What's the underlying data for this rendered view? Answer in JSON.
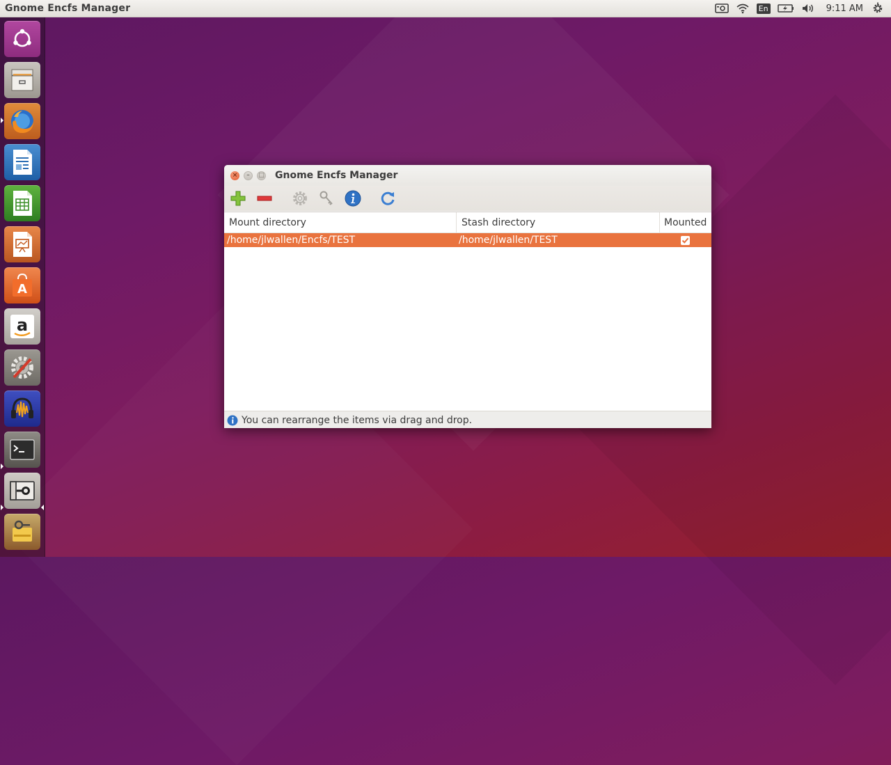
{
  "top_panel": {
    "app_title": "Gnome Encfs Manager",
    "keyboard_layout": "En",
    "clock": "9:11 AM",
    "indicator_icons": [
      "vault-indicator-icon",
      "wifi-icon",
      "keyboard-layout-icon",
      "battery-icon",
      "volume-icon",
      "system-gear-icon"
    ]
  },
  "launcher": {
    "items": [
      {
        "name": "ubuntu-dash-icon",
        "label": "Search your computer"
      },
      {
        "name": "file-cabinet-icon",
        "label": "Files"
      },
      {
        "name": "firefox-icon",
        "label": "Firefox Web Browser"
      },
      {
        "name": "libreoffice-writer-icon",
        "label": "LibreOffice Writer"
      },
      {
        "name": "libreoffice-calc-icon",
        "label": "LibreOffice Calc"
      },
      {
        "name": "libreoffice-impress-icon",
        "label": "LibreOffice Impress"
      },
      {
        "name": "software-center-icon",
        "label": "Ubuntu Software Center"
      },
      {
        "name": "amazon-icon",
        "label": "Amazon"
      },
      {
        "name": "system-settings-icon",
        "label": "System Settings"
      },
      {
        "name": "audacity-icon",
        "label": "Audacity"
      },
      {
        "name": "terminal-icon",
        "label": "Terminal"
      },
      {
        "name": "encfs-manager-icon",
        "label": "Gnome Encfs Manager"
      },
      {
        "name": "keys-vault-icon",
        "label": "Passwords and Keys"
      }
    ]
  },
  "window": {
    "title": "Gnome Encfs Manager",
    "toolbar_icons": [
      "add-icon",
      "remove-icon",
      "settings-gear-icon",
      "keys-icon",
      "info-icon",
      "refresh-icon"
    ],
    "columns": [
      "Mount directory",
      "Stash directory",
      "Mounted"
    ],
    "rows": [
      {
        "mount": "/home/jlwallen/Encfs/TEST",
        "stash": "/home/jlwallen/TEST",
        "mounted": true
      }
    ],
    "status_text": "You can rearrange the items via drag and drop."
  },
  "colors": {
    "selection": "#e9733e",
    "accent_ubuntu": "#dd4814"
  }
}
